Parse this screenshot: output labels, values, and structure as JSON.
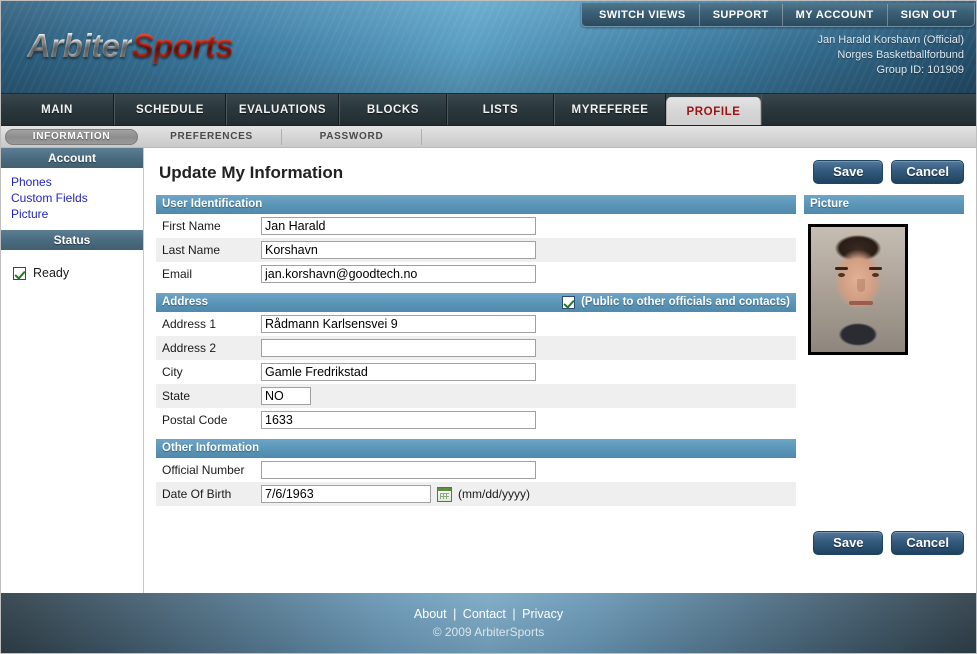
{
  "brand": {
    "part1": "Arbiter",
    "part2": "Sports"
  },
  "utility_nav": [
    {
      "label": "SWITCH VIEWS"
    },
    {
      "label": "SUPPORT"
    },
    {
      "label": "MY ACCOUNT"
    },
    {
      "label": "SIGN OUT"
    }
  ],
  "user_info": {
    "name": "Jan Harald Korshavn (Official)",
    "organization": "Norges Basketballforbund",
    "group_id": "Group ID: 101909"
  },
  "main_nav": [
    {
      "label": "MAIN",
      "active": false
    },
    {
      "label": "SCHEDULE",
      "active": false
    },
    {
      "label": "EVALUATIONS",
      "active": false
    },
    {
      "label": "BLOCKS",
      "active": false
    },
    {
      "label": "LISTS",
      "active": false
    },
    {
      "label": "MYREFEREE",
      "active": false
    },
    {
      "label": "PROFILE",
      "active": true
    }
  ],
  "sub_nav": [
    {
      "label": "INFORMATION",
      "active": true
    },
    {
      "label": "PREFERENCES",
      "active": false
    },
    {
      "label": "PASSWORD",
      "active": false
    }
  ],
  "sidebar": {
    "account_header": "Account",
    "account_links": [
      {
        "label": "Phones"
      },
      {
        "label": "Custom Fields"
      },
      {
        "label": "Picture"
      }
    ],
    "status_header": "Status",
    "status_item": {
      "label": "Ready",
      "checked": true
    }
  },
  "main": {
    "page_title": "Update My Information",
    "top_buttons": {
      "save": "Save",
      "cancel": "Cancel"
    },
    "bottom_buttons": {
      "save": "Save",
      "cancel": "Cancel"
    },
    "sections": {
      "user_identification": {
        "header": "User Identification",
        "fields": [
          {
            "label": "First Name",
            "value": "Jan Harald"
          },
          {
            "label": "Last Name",
            "value": "Korshavn"
          },
          {
            "label": "Email",
            "value": "jan.korshavn@goodtech.no"
          }
        ]
      },
      "address": {
        "header": "Address",
        "public_label": "(Public to other officials and contacts)",
        "public_checked": true,
        "fields": [
          {
            "label": "Address 1",
            "value": "Rådmann Karlsensvei 9"
          },
          {
            "label": "Address 2",
            "value": ""
          },
          {
            "label": "City",
            "value": "Gamle Fredrikstad"
          },
          {
            "label": "State",
            "value": "NO"
          },
          {
            "label": "Postal Code",
            "value": "1633"
          }
        ]
      },
      "other_information": {
        "header": "Other Information",
        "fields": [
          {
            "label": "Official Number",
            "value": ""
          },
          {
            "label": "Date Of Birth",
            "value": "7/6/1963",
            "hint": "(mm/dd/yyyy)"
          }
        ]
      }
    },
    "picture": {
      "header": "Picture"
    }
  },
  "footer": {
    "links": [
      {
        "label": "About"
      },
      {
        "label": "Contact"
      },
      {
        "label": "Privacy"
      }
    ],
    "separator": "|",
    "copyright": "© 2009 ArbiterSports"
  },
  "colors": {
    "accent_blue": "#5b96b9",
    "nav_dark": "#2b383d",
    "link_blue": "#2222cc",
    "active_tab_text": "#9e1414",
    "button_blue": "#335a7e"
  }
}
